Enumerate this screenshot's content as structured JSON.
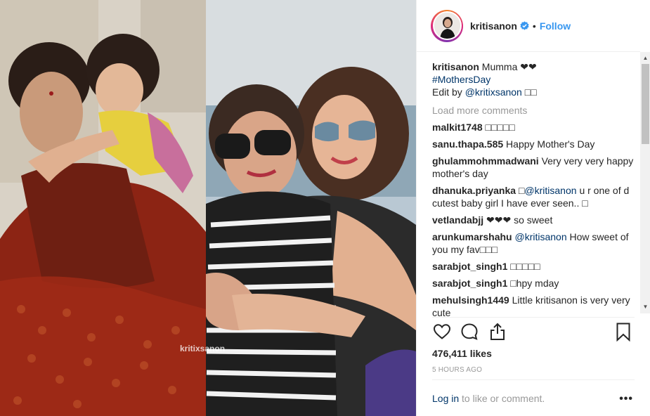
{
  "post": {
    "photo": {
      "watermark": "kritixsanon",
      "description_icon": "photo-collage"
    },
    "header": {
      "username": "kritisanon",
      "verified_icon": "verified-badge-icon",
      "separator": "•",
      "follow_label": "Follow",
      "colors": {
        "follow": "#3897f0",
        "verified": "#3897f0"
      }
    },
    "caption": {
      "username": "kritisanon",
      "text": "Mumma ❤❤",
      "hashtag": "#MothersDay",
      "edit_prefix": "Edit by",
      "edit_handle": "@kritixsanon",
      "edit_suffix": "□□"
    },
    "load_more_label": "Load more comments",
    "comments": [
      {
        "username": "malkit1748",
        "text": "□□□□□"
      },
      {
        "username": "sanu.thapa.585",
        "text": "Happy Mother's Day"
      },
      {
        "username": "ghulammohmmadwani",
        "text": "Very very very happy mother's day"
      },
      {
        "username": "dhanuka.priyanka",
        "text_prefix": "□",
        "mention": "@kritisanon",
        "text": "u r one of d cutest baby girl I have ever seen.. □"
      },
      {
        "username": "vetlandabjj",
        "text": "❤❤❤ so sweet"
      },
      {
        "username": "arunkumarshahu",
        "mention": "@kritisanon",
        "text": "How sweet of you my fav□□□"
      },
      {
        "username": "sarabjot_singh1",
        "text": "□□□□□"
      },
      {
        "username": "sarabjot_singh1",
        "text": "□hpy mday"
      },
      {
        "username": "mehulsingh1449",
        "text": "Little kritisanon is very very cute"
      }
    ],
    "actions": {
      "like_icon": "heart-icon",
      "comment_icon": "comment-icon",
      "share_icon": "share-icon",
      "save_icon": "bookmark-icon"
    },
    "likes_label": "476,411 likes",
    "timestamp": "5 HOURS AGO",
    "footer": {
      "login_label": "Log in",
      "rest_label": "to like or comment.",
      "more_label": "•••"
    },
    "scrollbar": {
      "up_glyph": "▲",
      "down_glyph": "▼"
    }
  }
}
